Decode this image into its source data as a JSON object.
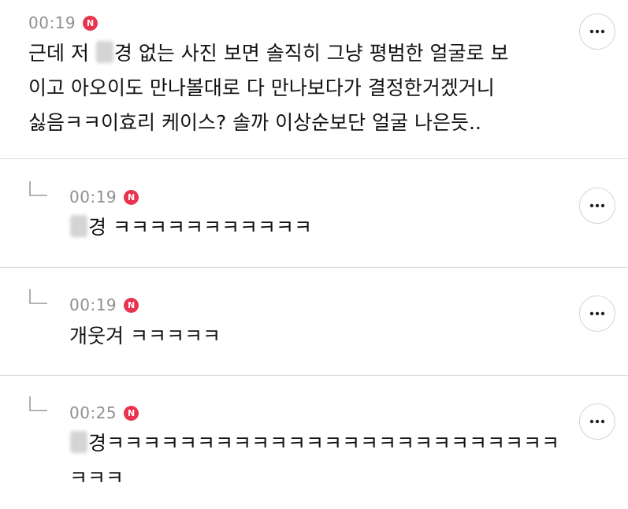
{
  "comments": [
    {
      "time": "00:19",
      "badge": "N",
      "lines": [
        [
          "근데 저 ",
          "경 없는 사진 보면 솔직히 그냥 평범한 얼굴로 보"
        ],
        "이고 아오이도 만나볼대로 다 만나보다가 결정한거겠거니",
        "싫음ㅋㅋ이효리 케이스? 솔까 이상순보단 얼굴 나은듯.."
      ]
    },
    {
      "time": "00:19",
      "badge": "N",
      "lines": [
        [
          "",
          "경 ㅋㅋㅋㅋㅋㅋㅋㅋㅋㅋㅋ"
        ]
      ]
    },
    {
      "time": "00:19",
      "badge": "N",
      "lines": [
        "개웃겨 ㅋㅋㅋㅋㅋ"
      ]
    },
    {
      "time": "00:25",
      "badge": "N",
      "lines": [
        [
          "",
          "경ㅋㅋㅋㅋㅋㅋㅋㅋㅋㅋㅋㅋㅋㅋㅋㅋㅋㅋㅋㅋㅋㅋㅋㅋㅋ"
        ],
        "ㅋㅋㅋ"
      ]
    }
  ],
  "icons": {
    "more": "more-horizontal-icon",
    "reply": "reply-arrow-icon"
  },
  "colors": {
    "badge": "#e8344e",
    "time": "#8f8f8f",
    "divider": "#dcdcdc"
  }
}
